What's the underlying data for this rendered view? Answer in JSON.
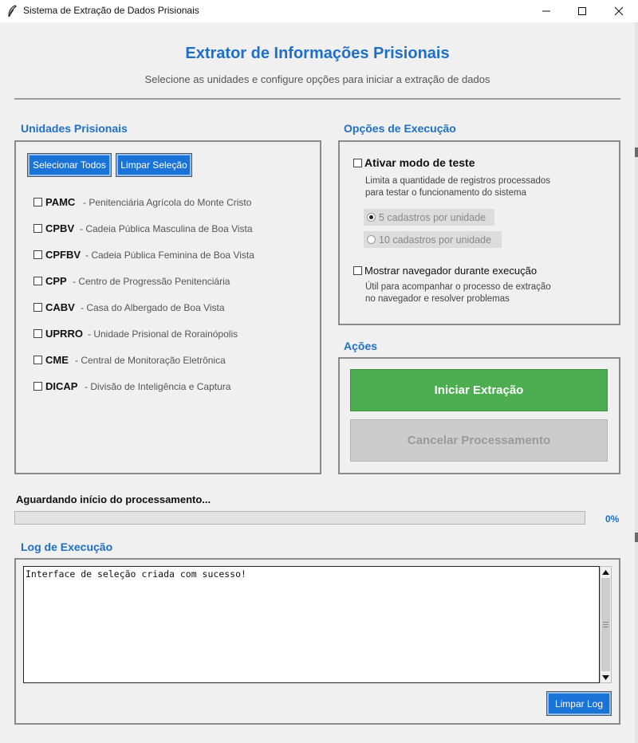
{
  "window": {
    "title": "Sistema de Extração de Dados Prisionais"
  },
  "header": {
    "title": "Extrator de Informações Prisionais",
    "subtitle": "Selecione as unidades e configure opções para iniciar a extração de dados"
  },
  "units_panel": {
    "label": "Unidades Prisionais",
    "select_all_label": "Selecionar Todos",
    "clear_selection_label": "Limpar Seleção",
    "units": [
      {
        "code": "PAMC",
        "desc": "- Penitenciária Agrícola do Monte Cristo",
        "checked": false
      },
      {
        "code": "CPBV",
        "desc": "- Cadeia Pública Masculina de Boa Vista",
        "checked": false
      },
      {
        "code": "CPFBV",
        "desc": "- Cadeia Pública Feminina de Boa Vista",
        "checked": false
      },
      {
        "code": "CPP",
        "desc": "- Centro de Progressão Penitenciária",
        "checked": false
      },
      {
        "code": "CABV",
        "desc": "- Casa do Albergado de Boa Vista",
        "checked": false
      },
      {
        "code": "UPRRO",
        "desc": "- Unidade Prisional de Rorainópolis",
        "checked": false
      },
      {
        "code": "CME",
        "desc": "- Central de Monitoração Eletrônica",
        "checked": false
      },
      {
        "code": "DICAP",
        "desc": "- Divisão de Inteligência e Captura",
        "checked": false
      }
    ]
  },
  "options_panel": {
    "label": "Opções de Execução",
    "test_mode": {
      "label": "Ativar modo de teste",
      "help_line1": "Limita a quantidade de registros processados",
      "help_line2": "para testar o funcionamento do sistema",
      "checked": false
    },
    "radio_options": [
      {
        "label": "5 cadastros por unidade",
        "selected": true
      },
      {
        "label": "10 cadastros por unidade",
        "selected": false
      }
    ],
    "show_browser": {
      "label": "Mostrar navegador durante execução",
      "help_line1": "Útil para acompanhar o processo de extração",
      "help_line2": "no navegador e resolver problemas",
      "checked": false
    }
  },
  "actions_panel": {
    "label": "Ações",
    "start_label": "Iniciar Extração",
    "cancel_label": "Cancelar Processamento"
  },
  "progress": {
    "status": "Aguardando início do processamento...",
    "percent_label": "0%",
    "fraction": 0
  },
  "log": {
    "label": "Log de Execução",
    "content": "Interface de seleção criada com sucesso!",
    "clear_label": "Limpar Log"
  },
  "colors": {
    "accent": "#1e6fc8",
    "button_blue": "#1a73d6",
    "start_green": "#4cae50",
    "disabled_gray": "#cccccc"
  }
}
